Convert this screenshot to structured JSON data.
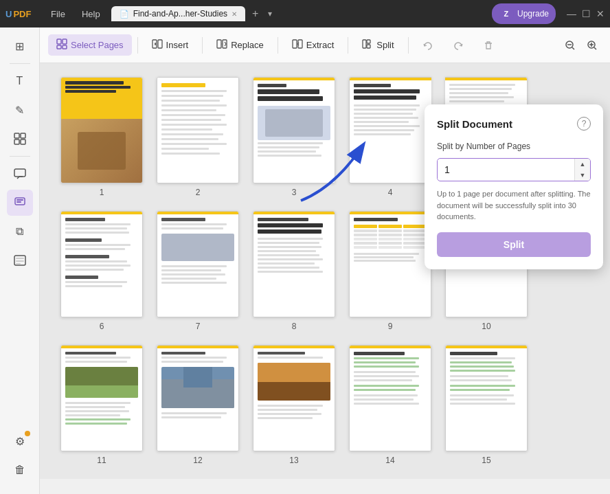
{
  "titlebar": {
    "logo": "UPDF",
    "logo_color_u": "#5b9bd5",
    "logo_color_pdf": "#e8a020",
    "menu": [
      "File",
      "Help"
    ],
    "tab_title": "Find-and-Ap...her-Studies",
    "tab_add": "+",
    "upgrade_label": "Upgrade",
    "upgrade_avatar": "Z",
    "window_controls": [
      "—",
      "☐",
      "✕"
    ]
  },
  "toolbar": {
    "select_pages": "Select Pages",
    "insert": "Insert",
    "replace": "Replace",
    "extract": "Extract",
    "split": "Split",
    "zoom_out": "−",
    "zoom_in": "+"
  },
  "sidebar": {
    "icons": [
      {
        "name": "thumbnail-view-icon",
        "symbol": "⊞",
        "active": false
      },
      {
        "name": "text-tool-icon",
        "symbol": "T",
        "active": false
      },
      {
        "name": "edit-icon",
        "symbol": "✎",
        "active": false
      },
      {
        "name": "organize-icon",
        "symbol": "⊟",
        "active": false
      },
      {
        "name": "comment-icon",
        "symbol": "💬",
        "active": false
      },
      {
        "name": "stamp-icon",
        "symbol": "✦",
        "active": true
      },
      {
        "name": "layers-icon",
        "symbol": "⧉",
        "active": false
      },
      {
        "name": "form-icon",
        "symbol": "☰",
        "active": false
      }
    ],
    "bottom_icons": [
      {
        "name": "settings-icon",
        "symbol": "⚙",
        "has_badge": true
      },
      {
        "name": "trash-sidebar-icon",
        "symbol": "🗑"
      }
    ]
  },
  "pages": [
    {
      "number": 1,
      "type": "cover"
    },
    {
      "number": 2,
      "type": "toc"
    },
    {
      "number": 3,
      "type": "article"
    },
    {
      "number": 4,
      "type": "article"
    },
    {
      "number": 5,
      "type": "article_partial"
    },
    {
      "number": 6,
      "type": "text_heavy"
    },
    {
      "number": 7,
      "type": "text_heavy"
    },
    {
      "number": 8,
      "type": "mixed"
    },
    {
      "number": 9,
      "type": "table"
    },
    {
      "number": 10,
      "type": "table"
    },
    {
      "number": 11,
      "type": "text_image"
    },
    {
      "number": 12,
      "type": "image_heavy"
    },
    {
      "number": 13,
      "type": "image_heavy"
    },
    {
      "number": 14,
      "type": "highlight"
    },
    {
      "number": 15,
      "type": "highlight"
    }
  ],
  "split_popup": {
    "title": "Split Document",
    "help_label": "?",
    "split_by_label": "Split by Number of Pages",
    "input_value": "1",
    "description": "Up to 1 page per document after splitting. The document will be successfully split into 30 documents.",
    "split_button": "Split"
  }
}
